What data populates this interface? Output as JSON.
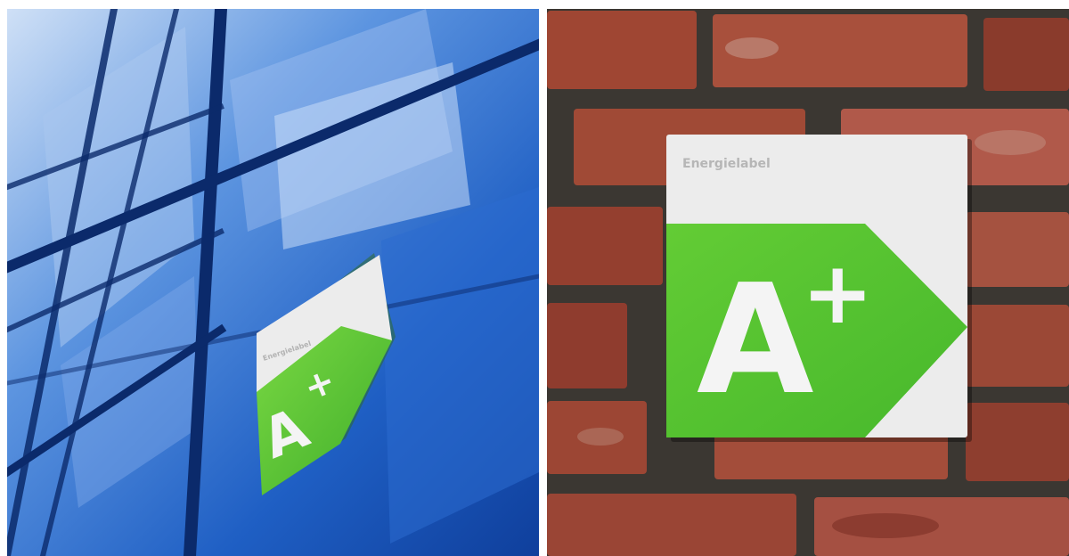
{
  "panels": [
    {
      "id": "glass-facade",
      "sign": {
        "title": "Energielabel",
        "rating": "A+",
        "rating_letter": "A",
        "rating_modifier": "+"
      }
    },
    {
      "id": "brick-wall",
      "sign": {
        "title": "Energielabel",
        "rating": "A+",
        "rating_letter": "A",
        "rating_modifier": "+"
      }
    }
  ],
  "colors": {
    "label_green": "#5cc832",
    "label_white": "#ececec",
    "glass_blue": "#1f5fc4",
    "brick_red": "#9a4a38"
  }
}
